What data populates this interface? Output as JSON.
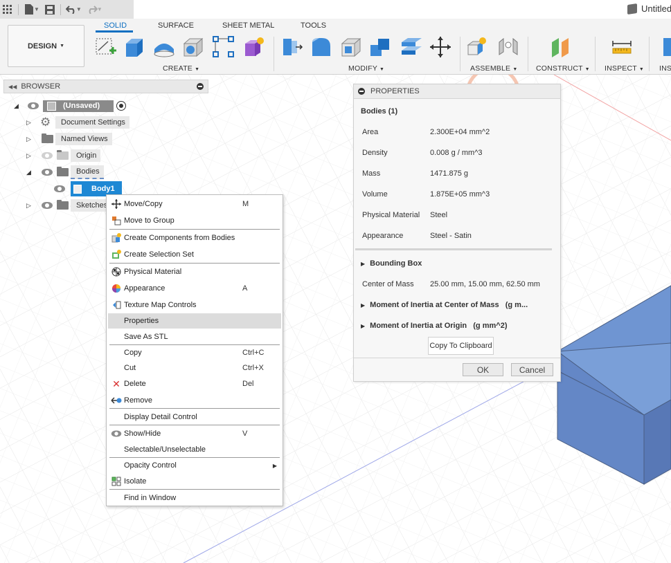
{
  "app": {
    "doc_title": "Untitled",
    "workspace_button": "DESIGN"
  },
  "tabs": [
    {
      "label": "SOLID",
      "active": true
    },
    {
      "label": "SURFACE",
      "active": false
    },
    {
      "label": "SHEET METAL",
      "active": false
    },
    {
      "label": "TOOLS",
      "active": false
    }
  ],
  "groups": {
    "create": "CREATE",
    "modify": "MODIFY",
    "assemble": "ASSEMBLE",
    "construct": "CONSTRUCT",
    "inspect": "INSPECT",
    "insert_partial": "INSE"
  },
  "browser": {
    "title": "BROWSER",
    "root": "(Unsaved)",
    "items": [
      {
        "label": "Document Settings",
        "icon": "gear-icon"
      },
      {
        "label": "Named Views",
        "icon": "folder-icon"
      },
      {
        "label": "Origin",
        "icon": "folder-icon"
      },
      {
        "label": "Bodies",
        "icon": "folder-icon"
      },
      {
        "label": "Body1",
        "icon": "body-icon"
      },
      {
        "label": "Sketches",
        "icon": "folder-icon"
      }
    ]
  },
  "context_menu": {
    "items": [
      {
        "label": "Move/Copy",
        "shortcut": "M",
        "icon": "move-icon"
      },
      {
        "label": "Move to Group",
        "shortcut": "",
        "icon": "group-icon"
      },
      {
        "label": "Create Components from Bodies",
        "shortcut": "",
        "icon": "components-icon"
      },
      {
        "label": "Create Selection Set",
        "shortcut": "",
        "icon": "selection-set-icon"
      },
      {
        "label": "Physical Material",
        "shortcut": "",
        "icon": "material-icon"
      },
      {
        "label": "Appearance",
        "shortcut": "A",
        "icon": "appearance-icon"
      },
      {
        "label": "Texture Map Controls",
        "shortcut": "",
        "icon": "texture-icon"
      },
      {
        "label": "Properties",
        "shortcut": "",
        "icon": ""
      },
      {
        "label": "Save As STL",
        "shortcut": "",
        "icon": ""
      },
      {
        "label": "Copy",
        "shortcut": "Ctrl+C",
        "icon": ""
      },
      {
        "label": "Cut",
        "shortcut": "Ctrl+X",
        "icon": ""
      },
      {
        "label": "Delete",
        "shortcut": "Del",
        "icon": "delete-icon"
      },
      {
        "label": "Remove",
        "shortcut": "",
        "icon": "remove-icon"
      },
      {
        "label": "Display Detail Control",
        "shortcut": "",
        "icon": ""
      },
      {
        "label": "Show/Hide",
        "shortcut": "V",
        "icon": "eye-icon"
      },
      {
        "label": "Selectable/Unselectable",
        "shortcut": "",
        "icon": ""
      },
      {
        "label": "Opacity Control",
        "shortcut": "",
        "icon": ""
      },
      {
        "label": "Isolate",
        "shortcut": "",
        "icon": "isolate-icon"
      },
      {
        "label": "Find in Window",
        "shortcut": "",
        "icon": ""
      }
    ]
  },
  "properties": {
    "title": "PROPERTIES",
    "heading": "Bodies (1)",
    "rows": [
      {
        "label": "Area",
        "value": "2.300E+04 mm^2"
      },
      {
        "label": "Density",
        "value": "0.008 g / mm^3"
      },
      {
        "label": "Mass",
        "value": "1471.875 g"
      },
      {
        "label": "Volume",
        "value": "1.875E+05 mm^3"
      },
      {
        "label": "Physical Material",
        "value": "Steel"
      },
      {
        "label": "Appearance",
        "value": "Steel - Satin"
      }
    ],
    "bounding_box": "Bounding Box",
    "center_of_mass_label": "Center of Mass",
    "center_of_mass_value": "25.00 mm, 15.00 mm, 62.50 mm",
    "moi_center": "Moment of Inertia at Center of Mass   (g m...",
    "moi_origin": "Moment of Inertia at Origin   (g mm^2)",
    "copy_button": "Copy To Clipboard",
    "ok": "OK",
    "cancel": "Cancel"
  },
  "colors": {
    "accent": "#0e6fc1",
    "selection": "#1e88d4",
    "body_blue": "#6f95d2"
  }
}
